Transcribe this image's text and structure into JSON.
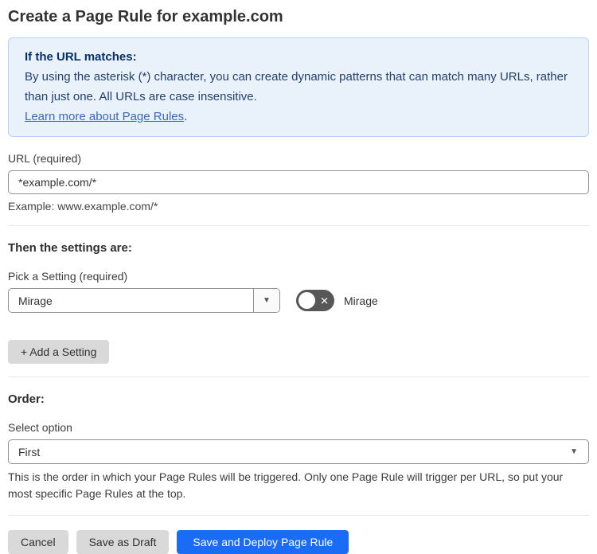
{
  "page": {
    "title": "Create a Page Rule for example.com"
  },
  "info_box": {
    "heading": "If the URL matches:",
    "body": "By using the asterisk (*) character, you can create dynamic patterns that can match many URLs, rather than just one. All URLs are case insensitive.",
    "link_label": "Learn more about Page Rules",
    "link_suffix": "."
  },
  "url_field": {
    "label": "URL (required)",
    "value": "*example.com/*",
    "example": "Example: www.example.com/*"
  },
  "settings_section": {
    "heading": "Then the settings are:",
    "pick_label": "Pick a Setting (required)",
    "selected_setting": "Mirage",
    "toggle": {
      "state": "off",
      "label": "Mirage",
      "off_glyph": "✕"
    },
    "add_button_label": "+ Add a Setting",
    "dropdown_arrow": "▼"
  },
  "order_section": {
    "heading": "Order:",
    "select_label": "Select option",
    "selected_option": "First",
    "help": "This is the order in which your Page Rules will be triggered. Only one Page Rule will trigger per URL, so put your most specific Page Rules at the top.",
    "dropdown_arrow": "▼"
  },
  "footer": {
    "cancel_label": "Cancel",
    "save_draft_label": "Save as Draft",
    "save_deploy_label": "Save and Deploy Page Rule"
  },
  "colors": {
    "accent_blue": "#1a6cf5",
    "info_background": "#e9f1fb",
    "info_border": "#b7d2f0",
    "info_heading": "#06306c",
    "info_text": "#24406e",
    "link_blue": "#3a67c6",
    "button_gray": "#d9d9d9",
    "toggle_off_gray": "#575757",
    "input_border": "#8f8f8f",
    "divider": "#e8e8e8"
  }
}
